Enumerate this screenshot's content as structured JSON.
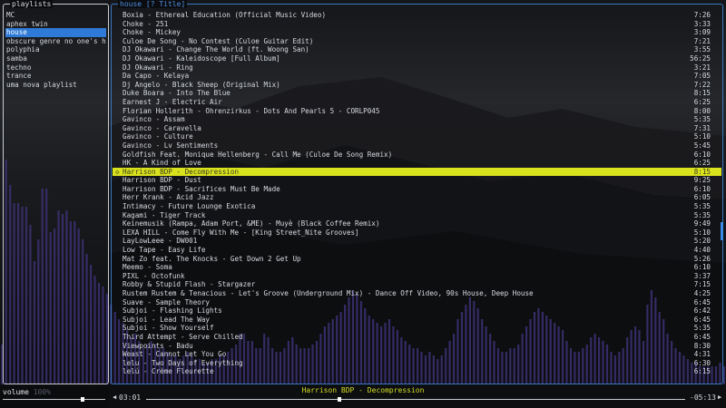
{
  "colors": {
    "accent": "#2f7ad6",
    "playing_bg": "#d9e21d",
    "playing_text": "#d6df22",
    "bars": "#3a2f6e"
  },
  "playlists_panel": {
    "title": "playlists",
    "items": [
      {
        "label": "MC"
      },
      {
        "label": "aphex twin"
      },
      {
        "label": "house"
      },
      {
        "label": "obscure genre no one's heard"
      },
      {
        "label": "polyphia"
      },
      {
        "label": "samba"
      },
      {
        "label": "techno"
      },
      {
        "label": "trance"
      },
      {
        "label": "uma nova playlist"
      }
    ],
    "selected_index": 2
  },
  "tracks_panel": {
    "title": "house [? Title]",
    "playing_index": 18,
    "tracks": [
      {
        "title": "Boxia - Ethereal Education (Official Music Video)",
        "duration": "7:26"
      },
      {
        "title": "Choke - 251",
        "duration": "3:33"
      },
      {
        "title": "Choke - Mickey",
        "duration": "3:09"
      },
      {
        "title": "Culoe De Song - No Contest (Culoe Guitar Edit)",
        "duration": "7:21"
      },
      {
        "title": "DJ Okawari - Change The World (ft. Woong San)",
        "duration": "3:55"
      },
      {
        "title": "DJ Okawari - Kaleidoscope [Full Album]",
        "duration": "56:25"
      },
      {
        "title": "DJ Okawari - Ring",
        "duration": "3:21"
      },
      {
        "title": "Da Capo - Kelaya",
        "duration": "7:05"
      },
      {
        "title": "Dj Angelo - Black Sheep (Original Mix)",
        "duration": "7:22"
      },
      {
        "title": "Duke Boara - Into The Blue",
        "duration": "8:15"
      },
      {
        "title": "Earnest J - Electric Air",
        "duration": "6:25"
      },
      {
        "title": "Florian Hollerith - Ohrenzirkus - Dots And Pearls 5 - CORLP045",
        "duration": "8:00"
      },
      {
        "title": "Gavinco - Assam",
        "duration": "5:35"
      },
      {
        "title": "Gavinco - Caravella",
        "duration": "7:31"
      },
      {
        "title": "Gavinco - Culture",
        "duration": "5:10"
      },
      {
        "title": "Gavinco - Lv Sentiments",
        "duration": "5:45"
      },
      {
        "title": "Goldfish Feat. Monique Hellenberg - Call Me (Culoe De Song Remix)",
        "duration": "6:10"
      },
      {
        "title": "HK - A Kind of Love",
        "duration": "6:25"
      },
      {
        "title": "Harrison BDP - Decompression",
        "duration": "8:15"
      },
      {
        "title": "Harrison BDP - Dust",
        "duration": "9:25"
      },
      {
        "title": "Harrison BDP - Sacrifices Must Be Made",
        "duration": "6:10"
      },
      {
        "title": "Herr Krank - Acid Jazz",
        "duration": "6:05"
      },
      {
        "title": "Intimacy - Future Lounge Exotica",
        "duration": "5:35"
      },
      {
        "title": "Kagami - Tiger Track",
        "duration": "5:35"
      },
      {
        "title": "Keinemusik (Rampa, Adam Port, &ME) - Muyè (Black Coffee Remix)",
        "duration": "9:49"
      },
      {
        "title": "LEXA HILL  - Come Fly With Me - [King Street_Nite Grooves]",
        "duration": "5:10"
      },
      {
        "title": "LayLowLeee - DW001",
        "duration": "5:20"
      },
      {
        "title": "Low Tape - Easy Life",
        "duration": "4:40"
      },
      {
        "title": "Mat Zo feat. The Knocks - Get Down 2 Get Up",
        "duration": "5:26"
      },
      {
        "title": "Meemo - Soma",
        "duration": "6:10"
      },
      {
        "title": "PIXL - Octofunk",
        "duration": "3:37"
      },
      {
        "title": "Robby & Stupid Flash - Stargazer",
        "duration": "7:15"
      },
      {
        "title": "Rustem Rustem & Tenacious -  Let's Groove (Underground Mix) - Dance Off Video, 90s House, Deep House",
        "duration": "4:25"
      },
      {
        "title": "Suave - Sample Theory",
        "duration": "6:45"
      },
      {
        "title": "Subjoi - Flashing Lights",
        "duration": "6:42"
      },
      {
        "title": "Subjoi - Lead The Way",
        "duration": "6:45"
      },
      {
        "title": "Subjoi - Show Yourself",
        "duration": "5:35"
      },
      {
        "title": "Third Attempt - Serve Chilled",
        "duration": "6:45"
      },
      {
        "title": "Viewpoints - Badu",
        "duration": "8:30"
      },
      {
        "title": "Weast - Cannot Let You Go",
        "duration": "4:31"
      },
      {
        "title": "lelu - Two Days of Everything",
        "duration": "6:30"
      },
      {
        "title": "lelú - Crème Fleurette",
        "duration": "6:15"
      }
    ]
  },
  "player": {
    "volume_label": "volume",
    "volume_value": "100%",
    "volume_level": 0.8,
    "elapsed": "03:01",
    "remaining": "-05:13",
    "now_playing": "Harrison BDP - Decompression",
    "seek_back_icon": "triangle-left",
    "seek_forward_icon": "triangle-right"
  },
  "visualizer_levels": [
    0.11,
    0.62,
    0.55,
    0.5,
    0.5,
    0.49,
    0.49,
    0.44,
    0.34,
    0.4,
    0.54,
    0.54,
    0.42,
    0.43,
    0.48,
    0.47,
    0.48,
    0.45,
    0.45,
    0.43,
    0.4,
    0.36,
    0.33,
    0.3,
    0.28,
    0.27,
    0.25,
    0.22,
    0.2,
    0.18,
    0.17,
    0.15,
    0.13,
    0.14,
    0.12,
    0.1,
    0.11,
    0.12,
    0.11,
    0.1,
    0.1,
    0.09,
    0.08,
    0.08,
    0.07,
    0.08,
    0.09,
    0.08,
    0.07,
    0.07,
    0.06,
    0.06,
    0.07,
    0.07,
    0.08,
    0.08,
    0.09,
    0.1,
    0.11,
    0.14,
    0.14,
    0.12,
    0.12,
    0.1,
    0.1,
    0.14,
    0.13,
    0.1,
    0.09,
    0.09,
    0.1,
    0.12,
    0.13,
    0.11,
    0.1,
    0.1,
    0.1,
    0.11,
    0.12,
    0.14,
    0.16,
    0.17,
    0.18,
    0.19,
    0.2,
    0.22,
    0.24,
    0.26,
    0.25,
    0.23,
    0.21,
    0.19,
    0.18,
    0.17,
    0.16,
    0.17,
    0.18,
    0.16,
    0.15,
    0.13,
    0.12,
    0.11,
    0.1,
    0.1,
    0.09,
    0.08,
    0.09,
    0.08,
    0.07,
    0.08,
    0.1,
    0.12,
    0.14,
    0.18,
    0.2,
    0.22,
    0.24,
    0.23,
    0.21,
    0.18,
    0.16,
    0.14,
    0.12,
    0.1,
    0.09,
    0.09,
    0.1,
    0.1,
    0.11,
    0.14,
    0.16,
    0.18,
    0.2,
    0.21,
    0.2,
    0.19,
    0.18,
    0.17,
    0.16,
    0.15,
    0.12,
    0.1,
    0.09,
    0.09,
    0.1,
    0.11,
    0.13,
    0.14,
    0.13,
    0.12,
    0.11,
    0.09,
    0.08,
    0.09,
    0.1,
    0.13,
    0.15,
    0.16,
    0.15,
    0.12,
    0.22,
    0.26,
    0.24,
    0.2,
    0.18,
    0.14,
    0.12,
    0.1,
    0.09,
    0.08,
    0.07,
    0.06,
    0.06,
    0.05,
    0.05,
    0.05,
    0.05,
    0.05,
    0.06,
    0.05
  ]
}
